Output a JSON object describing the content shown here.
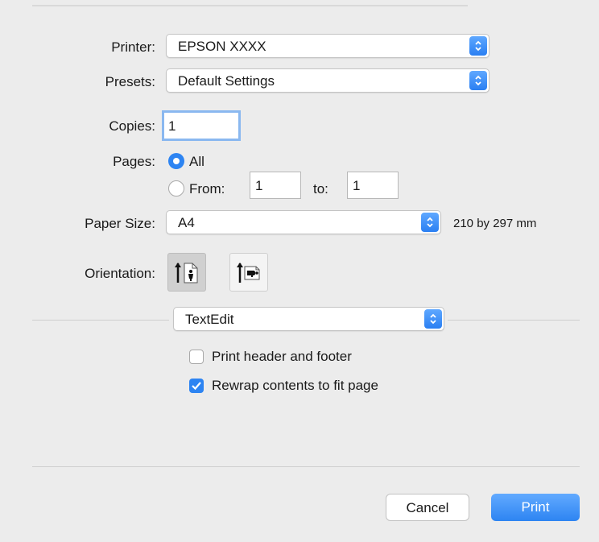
{
  "printer": {
    "label": "Printer:",
    "value": "EPSON XXXX"
  },
  "presets": {
    "label": "Presets:",
    "value": "Default Settings"
  },
  "copies": {
    "label": "Copies:",
    "value": "1"
  },
  "pages": {
    "label": "Pages:",
    "all_label": "All",
    "from_label": "From:",
    "from_value": "1",
    "to_label": "to:",
    "to_value": "1",
    "selected": "All"
  },
  "paper_size": {
    "label": "Paper Size:",
    "value": "A4",
    "dimensions": "210 by 297 mm"
  },
  "orientation": {
    "label": "Orientation:",
    "selected": "portrait"
  },
  "section_popup": {
    "value": "TextEdit"
  },
  "options": {
    "print_header_footer": {
      "label": "Print header and footer",
      "checked": false
    },
    "rewrap_contents": {
      "label": "Rewrap contents to fit page",
      "checked": true
    }
  },
  "buttons": {
    "cancel": "Cancel",
    "print": "Print"
  },
  "colors": {
    "accent": "#2d84f2",
    "background": "#ececec"
  }
}
